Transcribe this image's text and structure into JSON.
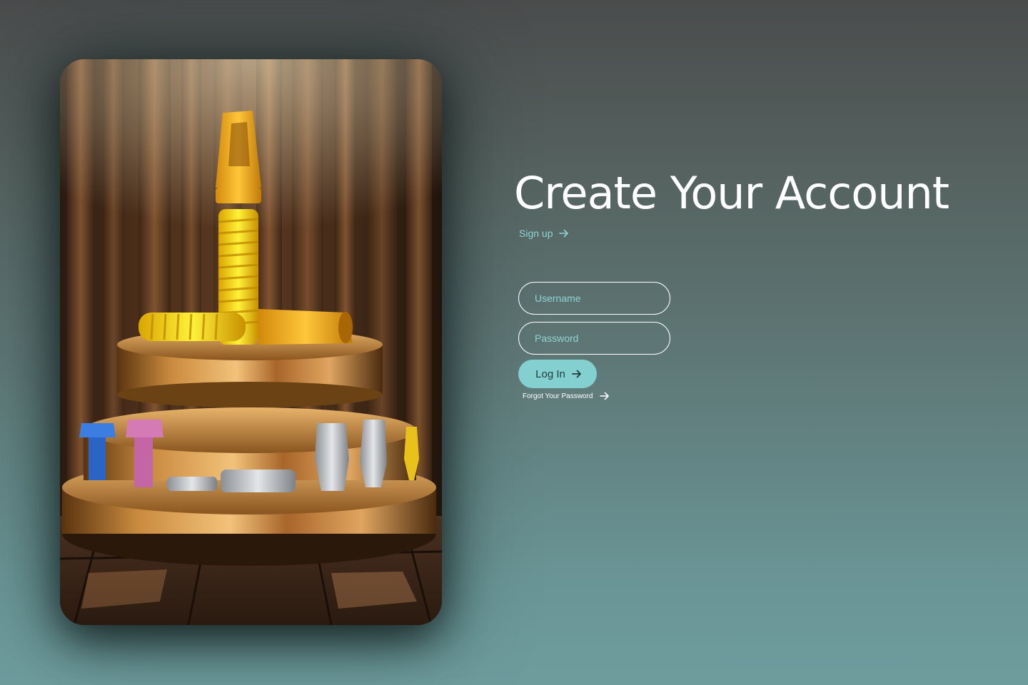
{
  "auth": {
    "title": "Create Your Account",
    "signup_label": "Sign up",
    "username_placeholder": "Username",
    "password_placeholder": "Password",
    "login_label": "Log In",
    "forgot_label": "Forgot Your Password"
  },
  "icons": {
    "signup_arrow": "arrow-right-icon",
    "login_arrow": "arrow-right-icon",
    "forgot_arrow": "arrow-right-icon"
  },
  "colors": {
    "accent": "#84cfcf",
    "link": "#8fd3d3",
    "title": "#ffffff",
    "button_text": "#1f3b3b",
    "background_top": "#4a4c4c",
    "background_bottom": "#6e9c9d"
  }
}
